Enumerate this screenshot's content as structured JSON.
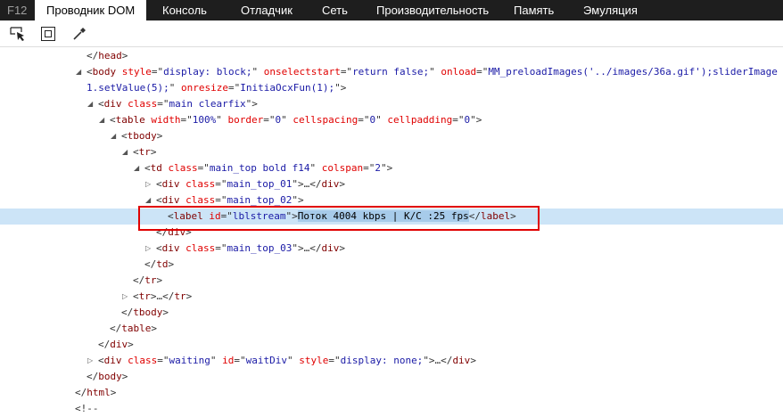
{
  "tabs": [
    {
      "label": "F12",
      "kind": "f12"
    },
    {
      "label": "Проводник DOM",
      "active": true
    },
    {
      "label": "Консоль"
    },
    {
      "label": "Отладчик"
    },
    {
      "label": "Сеть"
    },
    {
      "label": "Производительность"
    },
    {
      "label": "Память"
    },
    {
      "label": "Эмуляция"
    }
  ],
  "toolbar": [
    "select-element-icon",
    "highlight-box-icon",
    "color-picker-icon"
  ],
  "colors": {
    "tag": "#800000",
    "attr_name": "#e00000",
    "attr_value": "#1a1aa6",
    "selected_row": "#cce4f7",
    "highlight_box": "#e00000"
  },
  "rows": [
    {
      "level": 1,
      "toggle": "none",
      "tokens": [
        [
          "p",
          "</"
        ],
        [
          "tg",
          "head"
        ],
        [
          "p",
          ">"
        ]
      ]
    },
    {
      "level": 1,
      "toggle": "open",
      "tokens": [
        [
          "p",
          "<"
        ],
        [
          "tg",
          "body"
        ],
        [
          "p",
          " "
        ],
        [
          "an",
          "style"
        ],
        [
          "p",
          "=\""
        ],
        [
          "av",
          "display: block;"
        ],
        [
          "p",
          "\" "
        ],
        [
          "an",
          "onselectstart"
        ],
        [
          "p",
          "=\""
        ],
        [
          "av",
          "return false;"
        ],
        [
          "p",
          "\" "
        ],
        [
          "an",
          "onload"
        ],
        [
          "p",
          "=\""
        ],
        [
          "av",
          "MM_preloadImages('../images/36a.gif');sliderImage"
        ]
      ]
    },
    {
      "level": 1,
      "toggle": "none",
      "tokens": [
        [
          "av",
          "1.setValue(5);"
        ],
        [
          "p",
          "\" "
        ],
        [
          "an",
          "onresize"
        ],
        [
          "p",
          "=\""
        ],
        [
          "av",
          "InitiaOcxFun(1);"
        ],
        [
          "p",
          "\">"
        ]
      ]
    },
    {
      "level": 2,
      "toggle": "open",
      "tokens": [
        [
          "p",
          "<"
        ],
        [
          "tg",
          "div"
        ],
        [
          "p",
          " "
        ],
        [
          "an",
          "class"
        ],
        [
          "p",
          "=\""
        ],
        [
          "av",
          "main clearfix"
        ],
        [
          "p",
          "\">"
        ]
      ]
    },
    {
      "level": 3,
      "toggle": "open",
      "tokens": [
        [
          "p",
          "<"
        ],
        [
          "tg",
          "table"
        ],
        [
          "p",
          " "
        ],
        [
          "an",
          "width"
        ],
        [
          "p",
          "=\""
        ],
        [
          "av",
          "100%"
        ],
        [
          "p",
          "\" "
        ],
        [
          "an",
          "border"
        ],
        [
          "p",
          "=\""
        ],
        [
          "av",
          "0"
        ],
        [
          "p",
          "\" "
        ],
        [
          "an",
          "cellspacing"
        ],
        [
          "p",
          "=\""
        ],
        [
          "av",
          "0"
        ],
        [
          "p",
          "\" "
        ],
        [
          "an",
          "cellpadding"
        ],
        [
          "p",
          "=\""
        ],
        [
          "av",
          "0"
        ],
        [
          "p",
          "\">"
        ]
      ]
    },
    {
      "level": 4,
      "toggle": "open",
      "tokens": [
        [
          "p",
          "<"
        ],
        [
          "tg",
          "tbody"
        ],
        [
          "p",
          ">"
        ]
      ]
    },
    {
      "level": 5,
      "toggle": "open",
      "tokens": [
        [
          "p",
          "<"
        ],
        [
          "tg",
          "tr"
        ],
        [
          "p",
          ">"
        ]
      ]
    },
    {
      "level": 6,
      "toggle": "open",
      "tokens": [
        [
          "p",
          "<"
        ],
        [
          "tg",
          "td"
        ],
        [
          "p",
          " "
        ],
        [
          "an",
          "class"
        ],
        [
          "p",
          "=\""
        ],
        [
          "av",
          "main_top bold f14"
        ],
        [
          "p",
          "\" "
        ],
        [
          "an",
          "colspan"
        ],
        [
          "p",
          "=\""
        ],
        [
          "av",
          "2"
        ],
        [
          "p",
          "\">"
        ]
      ]
    },
    {
      "level": 7,
      "toggle": "closed",
      "tokens": [
        [
          "p",
          "<"
        ],
        [
          "tg",
          "div"
        ],
        [
          "p",
          " "
        ],
        [
          "an",
          "class"
        ],
        [
          "p",
          "=\""
        ],
        [
          "av",
          "main_top_01"
        ],
        [
          "p",
          "\">…</"
        ],
        [
          "tg",
          "div"
        ],
        [
          "p",
          ">"
        ]
      ]
    },
    {
      "level": 7,
      "toggle": "open",
      "tokens": [
        [
          "p",
          "<"
        ],
        [
          "tg",
          "div"
        ],
        [
          "p",
          " "
        ],
        [
          "an",
          "class"
        ],
        [
          "p",
          "=\""
        ],
        [
          "av",
          "main_top_02"
        ],
        [
          "p",
          "\">"
        ]
      ]
    },
    {
      "level": 8,
      "toggle": "none",
      "selected": true,
      "tokens": [
        [
          "p",
          "<"
        ],
        [
          "tg",
          "label"
        ],
        [
          "p",
          " "
        ],
        [
          "an",
          "id"
        ],
        [
          "p",
          "=\""
        ],
        [
          "av",
          "lblstream"
        ],
        [
          "p",
          "\">"
        ],
        [
          "hl",
          "Поток 4004 kbps | K/C :25 fps"
        ],
        [
          "p",
          "</"
        ],
        [
          "tg",
          "label"
        ],
        [
          "p",
          ">"
        ]
      ]
    },
    {
      "level": 7,
      "toggle": "none",
      "tokens": [
        [
          "p",
          "</"
        ],
        [
          "tg",
          "div"
        ],
        [
          "p",
          ">"
        ]
      ]
    },
    {
      "level": 7,
      "toggle": "closed",
      "tokens": [
        [
          "p",
          "<"
        ],
        [
          "tg",
          "div"
        ],
        [
          "p",
          " "
        ],
        [
          "an",
          "class"
        ],
        [
          "p",
          "=\""
        ],
        [
          "av",
          "main_top_03"
        ],
        [
          "p",
          "\">…</"
        ],
        [
          "tg",
          "div"
        ],
        [
          "p",
          ">"
        ]
      ]
    },
    {
      "level": 6,
      "toggle": "none",
      "tokens": [
        [
          "p",
          "</"
        ],
        [
          "tg",
          "td"
        ],
        [
          "p",
          ">"
        ]
      ]
    },
    {
      "level": 5,
      "toggle": "none",
      "tokens": [
        [
          "p",
          "</"
        ],
        [
          "tg",
          "tr"
        ],
        [
          "p",
          ">"
        ]
      ]
    },
    {
      "level": 5,
      "toggle": "closed",
      "tokens": [
        [
          "p",
          "<"
        ],
        [
          "tg",
          "tr"
        ],
        [
          "p",
          ">…</"
        ],
        [
          "tg",
          "tr"
        ],
        [
          "p",
          ">"
        ]
      ]
    },
    {
      "level": 4,
      "toggle": "none",
      "tokens": [
        [
          "p",
          "</"
        ],
        [
          "tg",
          "tbody"
        ],
        [
          "p",
          ">"
        ]
      ]
    },
    {
      "level": 3,
      "toggle": "none",
      "tokens": [
        [
          "p",
          "</"
        ],
        [
          "tg",
          "table"
        ],
        [
          "p",
          ">"
        ]
      ]
    },
    {
      "level": 2,
      "toggle": "none",
      "tokens": [
        [
          "p",
          "</"
        ],
        [
          "tg",
          "div"
        ],
        [
          "p",
          ">"
        ]
      ]
    },
    {
      "level": 2,
      "toggle": "closed",
      "tokens": [
        [
          "p",
          "<"
        ],
        [
          "tg",
          "div"
        ],
        [
          "p",
          " "
        ],
        [
          "an",
          "class"
        ],
        [
          "p",
          "=\""
        ],
        [
          "av",
          "waiting"
        ],
        [
          "p",
          "\" "
        ],
        [
          "an",
          "id"
        ],
        [
          "p",
          "=\""
        ],
        [
          "av",
          "waitDiv"
        ],
        [
          "p",
          "\" "
        ],
        [
          "an",
          "style"
        ],
        [
          "p",
          "=\""
        ],
        [
          "av",
          "display: none;"
        ],
        [
          "p",
          "\">…</"
        ],
        [
          "tg",
          "div"
        ],
        [
          "p",
          ">"
        ]
      ]
    },
    {
      "level": 1,
      "toggle": "none",
      "tokens": [
        [
          "p",
          "</"
        ],
        [
          "tg",
          "body"
        ],
        [
          "p",
          ">"
        ]
      ]
    },
    {
      "level": 0,
      "toggle": "none",
      "tokens": [
        [
          "p",
          "</"
        ],
        [
          "tg",
          "html"
        ],
        [
          "p",
          ">"
        ]
      ]
    },
    {
      "level": 0,
      "toggle": "none",
      "tokens": [
        [
          "p",
          "<!--"
        ]
      ]
    }
  ]
}
